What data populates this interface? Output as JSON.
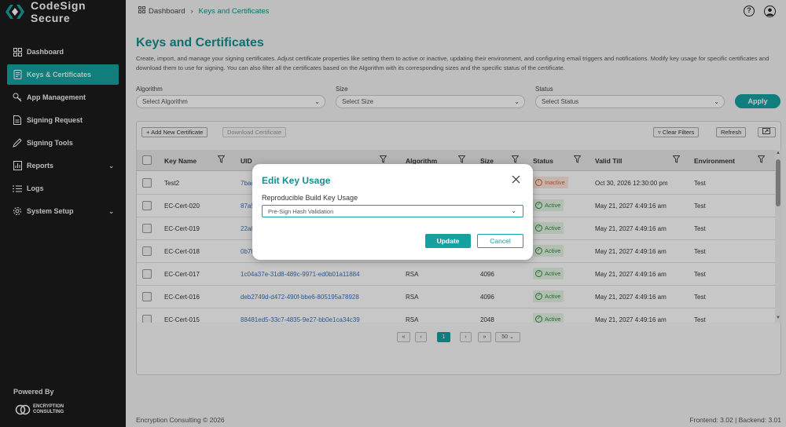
{
  "app": {
    "name": "CodeSign Secure"
  },
  "sidebar": {
    "items": [
      {
        "label": "Dashboard",
        "icon": "dashboard-icon",
        "active": false
      },
      {
        "label": "Keys & Certificates",
        "icon": "certificate-icon",
        "active": true
      },
      {
        "label": "App Management",
        "icon": "key-icon",
        "active": false
      },
      {
        "label": "Signing Request",
        "icon": "document-icon",
        "active": false
      },
      {
        "label": "Signing Tools",
        "icon": "pen-icon",
        "active": false
      },
      {
        "label": "Reports",
        "icon": "report-icon",
        "active": false,
        "expandable": true
      },
      {
        "label": "Logs",
        "icon": "logs-icon",
        "active": false
      },
      {
        "label": "System Setup",
        "icon": "settings-icon",
        "active": false,
        "expandable": true
      }
    ],
    "powered_by": "Powered By",
    "partner_logo_lines": [
      "ENCRYPTION",
      "CONSULTING"
    ]
  },
  "topbar": {
    "breadcrumb": {
      "home": "Dashboard",
      "current": "Keys and Certificates"
    }
  },
  "page": {
    "title": "Keys and Certificates",
    "description": "Create, import, and manage your signing certificates. Adjust certificate properties like setting them to active or inactive, updating their environment, and configuring email triggers and notifications. Modify key usage for specific certificates and download them to use for signing. You can also filter all the certificates based on the Algorithm with its corresponding sizes and the specific status of the certificate."
  },
  "filters": {
    "algorithm": {
      "label": "Algorithm",
      "placeholder": "Select Algorithm"
    },
    "size": {
      "label": "Size",
      "placeholder": "Select Size"
    },
    "status": {
      "label": "Status",
      "placeholder": "Select Status"
    },
    "apply_label": "Apply"
  },
  "toolbar": {
    "add_label": "Add New Certificate",
    "download_label": "Download Certificate",
    "clear_label": "Clear Filters",
    "refresh_label": "Refresh"
  },
  "table": {
    "columns": [
      "Key Name",
      "UID",
      "Algorithm",
      "Size",
      "Status",
      "Valid Till",
      "Environment"
    ],
    "rows": [
      {
        "key_name": "Test2",
        "uid": "7bac",
        "algorithm": "",
        "size": "",
        "status": "Inactive",
        "valid_till": "Oct 30, 2026 12:30:00 pm",
        "environment": "Test"
      },
      {
        "key_name": "EC-Cert-020",
        "uid": "87a5",
        "algorithm": "",
        "size": "",
        "status": "Active",
        "valid_till": "May 21, 2027 4:49:16 am",
        "environment": "Test"
      },
      {
        "key_name": "EC-Cert-019",
        "uid": "22a8",
        "algorithm": "",
        "size": "",
        "status": "Active",
        "valid_till": "May 21, 2027 4:49:16 am",
        "environment": "Test"
      },
      {
        "key_name": "EC-Cert-018",
        "uid": "0b7f",
        "algorithm": "",
        "size": "",
        "status": "Active",
        "valid_till": "May 21, 2027 4:49:16 am",
        "environment": "Test"
      },
      {
        "key_name": "EC-Cert-017",
        "uid": "1c04a37e-31d8-489c-9971-ed0b01a11884",
        "algorithm": "RSA",
        "size": "4096",
        "status": "Active",
        "valid_till": "May 21, 2027 4:49:16 am",
        "environment": "Test"
      },
      {
        "key_name": "EC-Cert-016",
        "uid": "deb2749d-d472-490f-bbe6-805195a78928",
        "algorithm": "RSA",
        "size": "4096",
        "status": "Active",
        "valid_till": "May 21, 2027 4:49:16 am",
        "environment": "Test"
      },
      {
        "key_name": "EC-Cert-015",
        "uid": "88481ed5-33c7-4835-9e27-bb0e1ca34c39",
        "algorithm": "RSA",
        "size": "2048",
        "status": "Active",
        "valid_till": "May 21, 2027 4:49:16 am",
        "environment": "Test"
      }
    ]
  },
  "pagination": {
    "first": "«",
    "prev": "‹",
    "current_page": "1",
    "next": "›",
    "last": "»",
    "page_size": "50"
  },
  "footer": {
    "copyright": "Encryption Consulting © 2026",
    "versions": "Frontend: 3.02 | Backend: 3.01"
  },
  "modal": {
    "title": "Edit Key Usage",
    "field_label": "Reproducible Build Key Usage",
    "field_value": "Pre-Sign Hash Validation",
    "update_label": "Update",
    "cancel_label": "Cancel"
  },
  "colors": {
    "accent": "#17a0a0",
    "sidebar_bg": "#1b1b1b",
    "active_badge": "#2e8b3e",
    "inactive_badge": "#d9603a",
    "uid_link": "#3a6fb8"
  }
}
